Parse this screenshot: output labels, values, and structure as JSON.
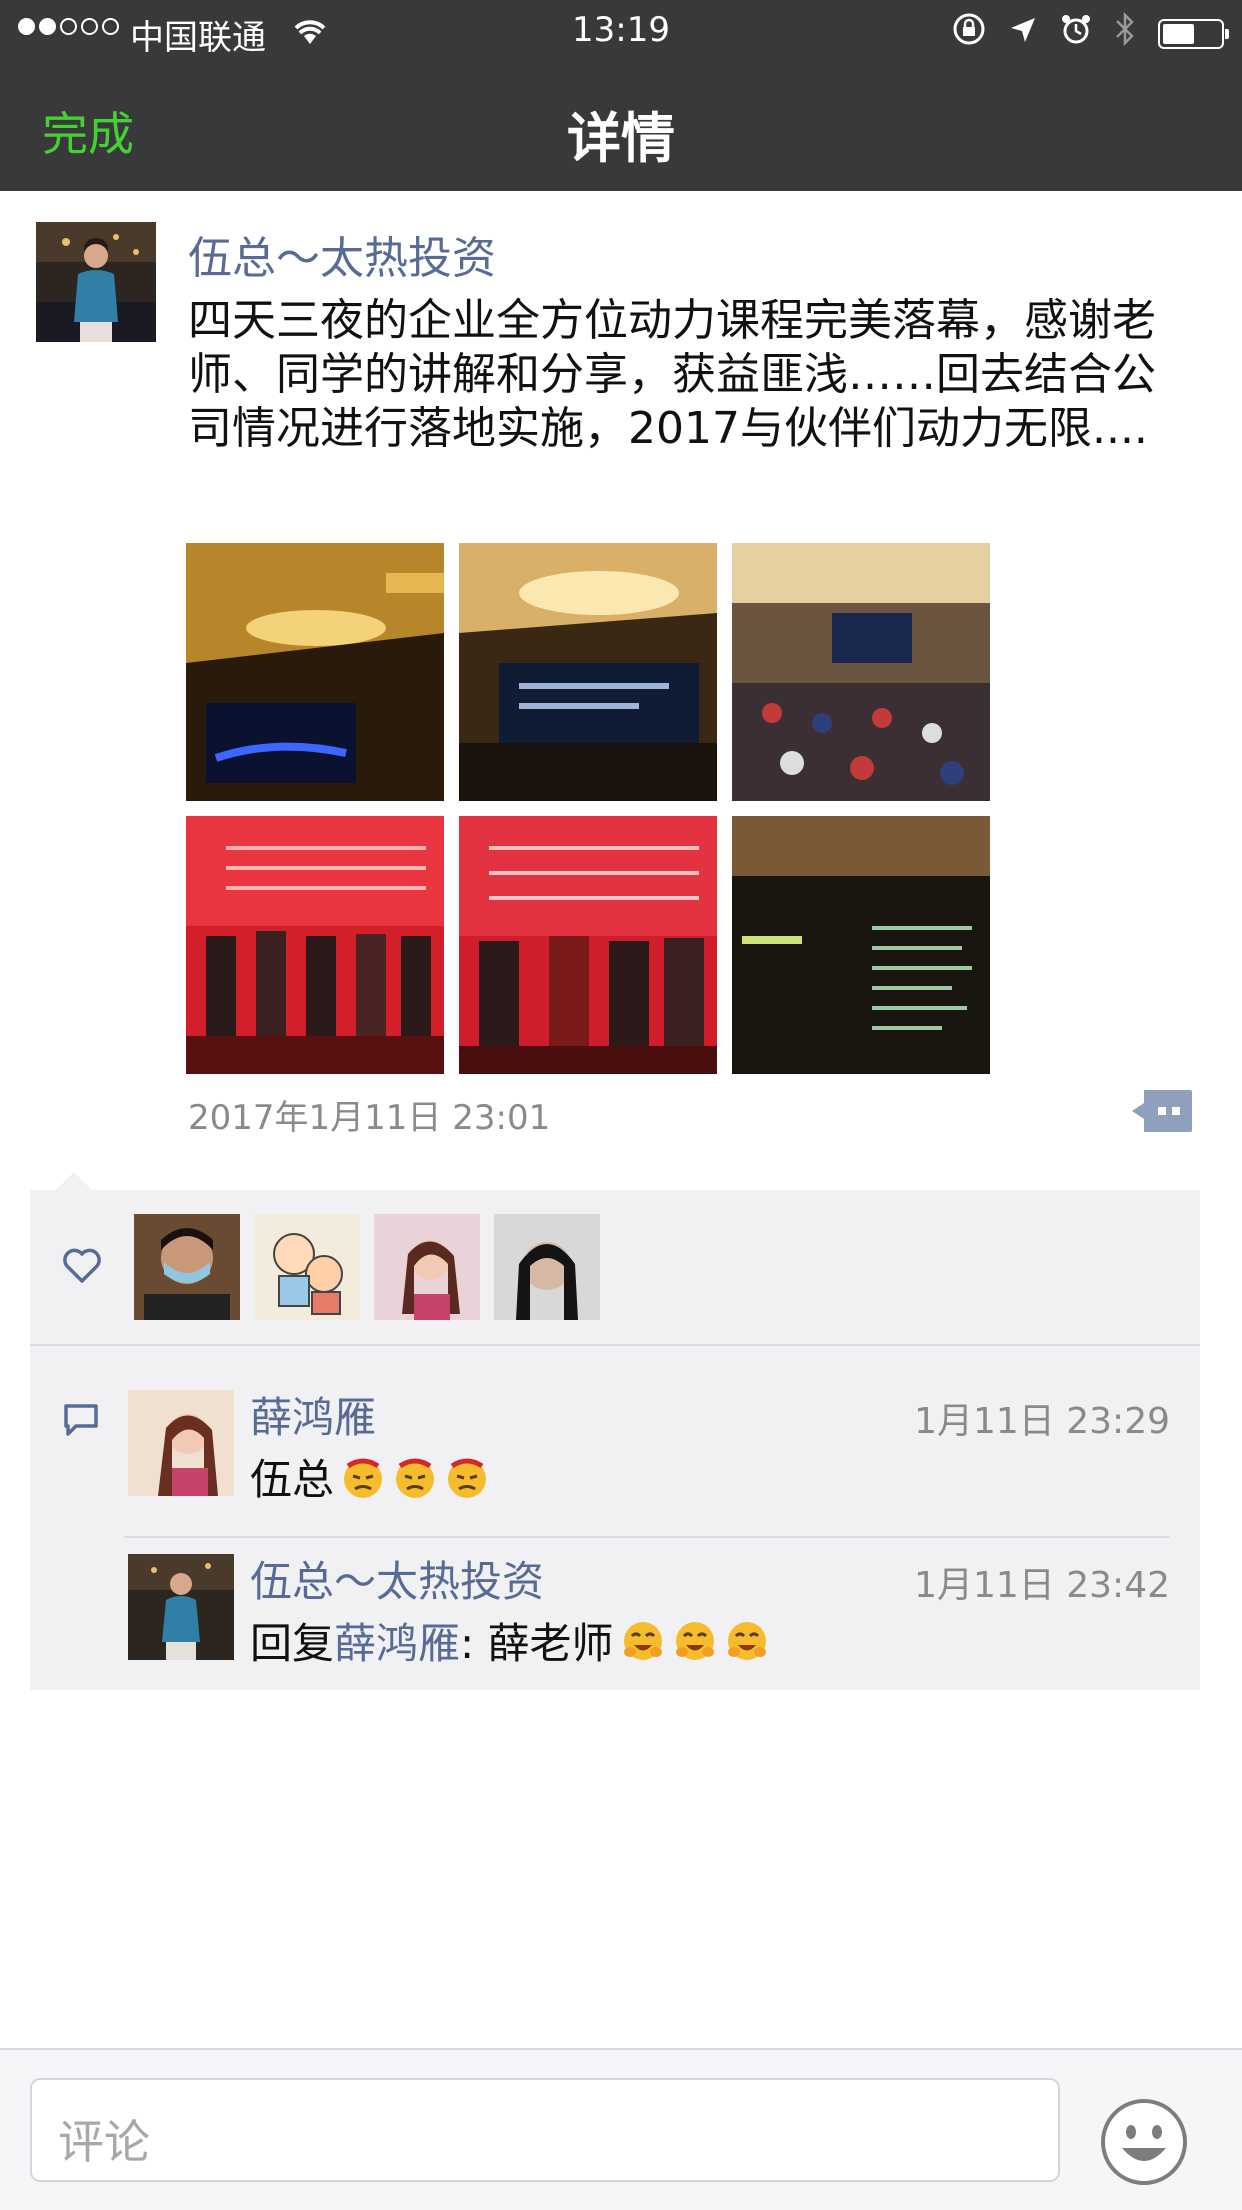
{
  "status_bar": {
    "carrier": "中国联通",
    "time": "13:19",
    "battery_level": 0.55
  },
  "nav": {
    "back_label": "完成",
    "title": "详情"
  },
  "post": {
    "author": "伍总～太热投资",
    "text": "四天三夜的企业全方位动力课程完美落幕，感谢老师、同学的讲解和分享，获益匪浅……回去结合公司情况进行落地实施，2017与伙伴们动力无限....",
    "time": "2017年1月11日 23:01",
    "photos": [
      "conference-hall-ceiling-screen",
      "conference-hall-speaker-screen",
      "conference-audience",
      "award-ceremony-red-screen",
      "award-ceremony-group",
      "screen-text-slide"
    ]
  },
  "likes": {
    "users": [
      "liker-1",
      "liker-2",
      "liker-3",
      "liker-4"
    ]
  },
  "comments": [
    {
      "author": "薛鸿雁",
      "time": "1月11日 23:29",
      "text": "伍总",
      "emoji": "angry-face-emoji"
    },
    {
      "author": "伍总～太热投资",
      "time": "1月11日 23:42",
      "reply_prefix": "回复",
      "reply_to": "薛鸿雁",
      "text": ": 薛老师",
      "emoji": "laughing-face-emoji"
    }
  ],
  "comment_bar": {
    "placeholder": "评论"
  },
  "colors": {
    "nav_bg": "#39393b",
    "accent_green": "#44d232",
    "link_blue": "#576b95",
    "panel_bg": "#f1f1f4"
  }
}
